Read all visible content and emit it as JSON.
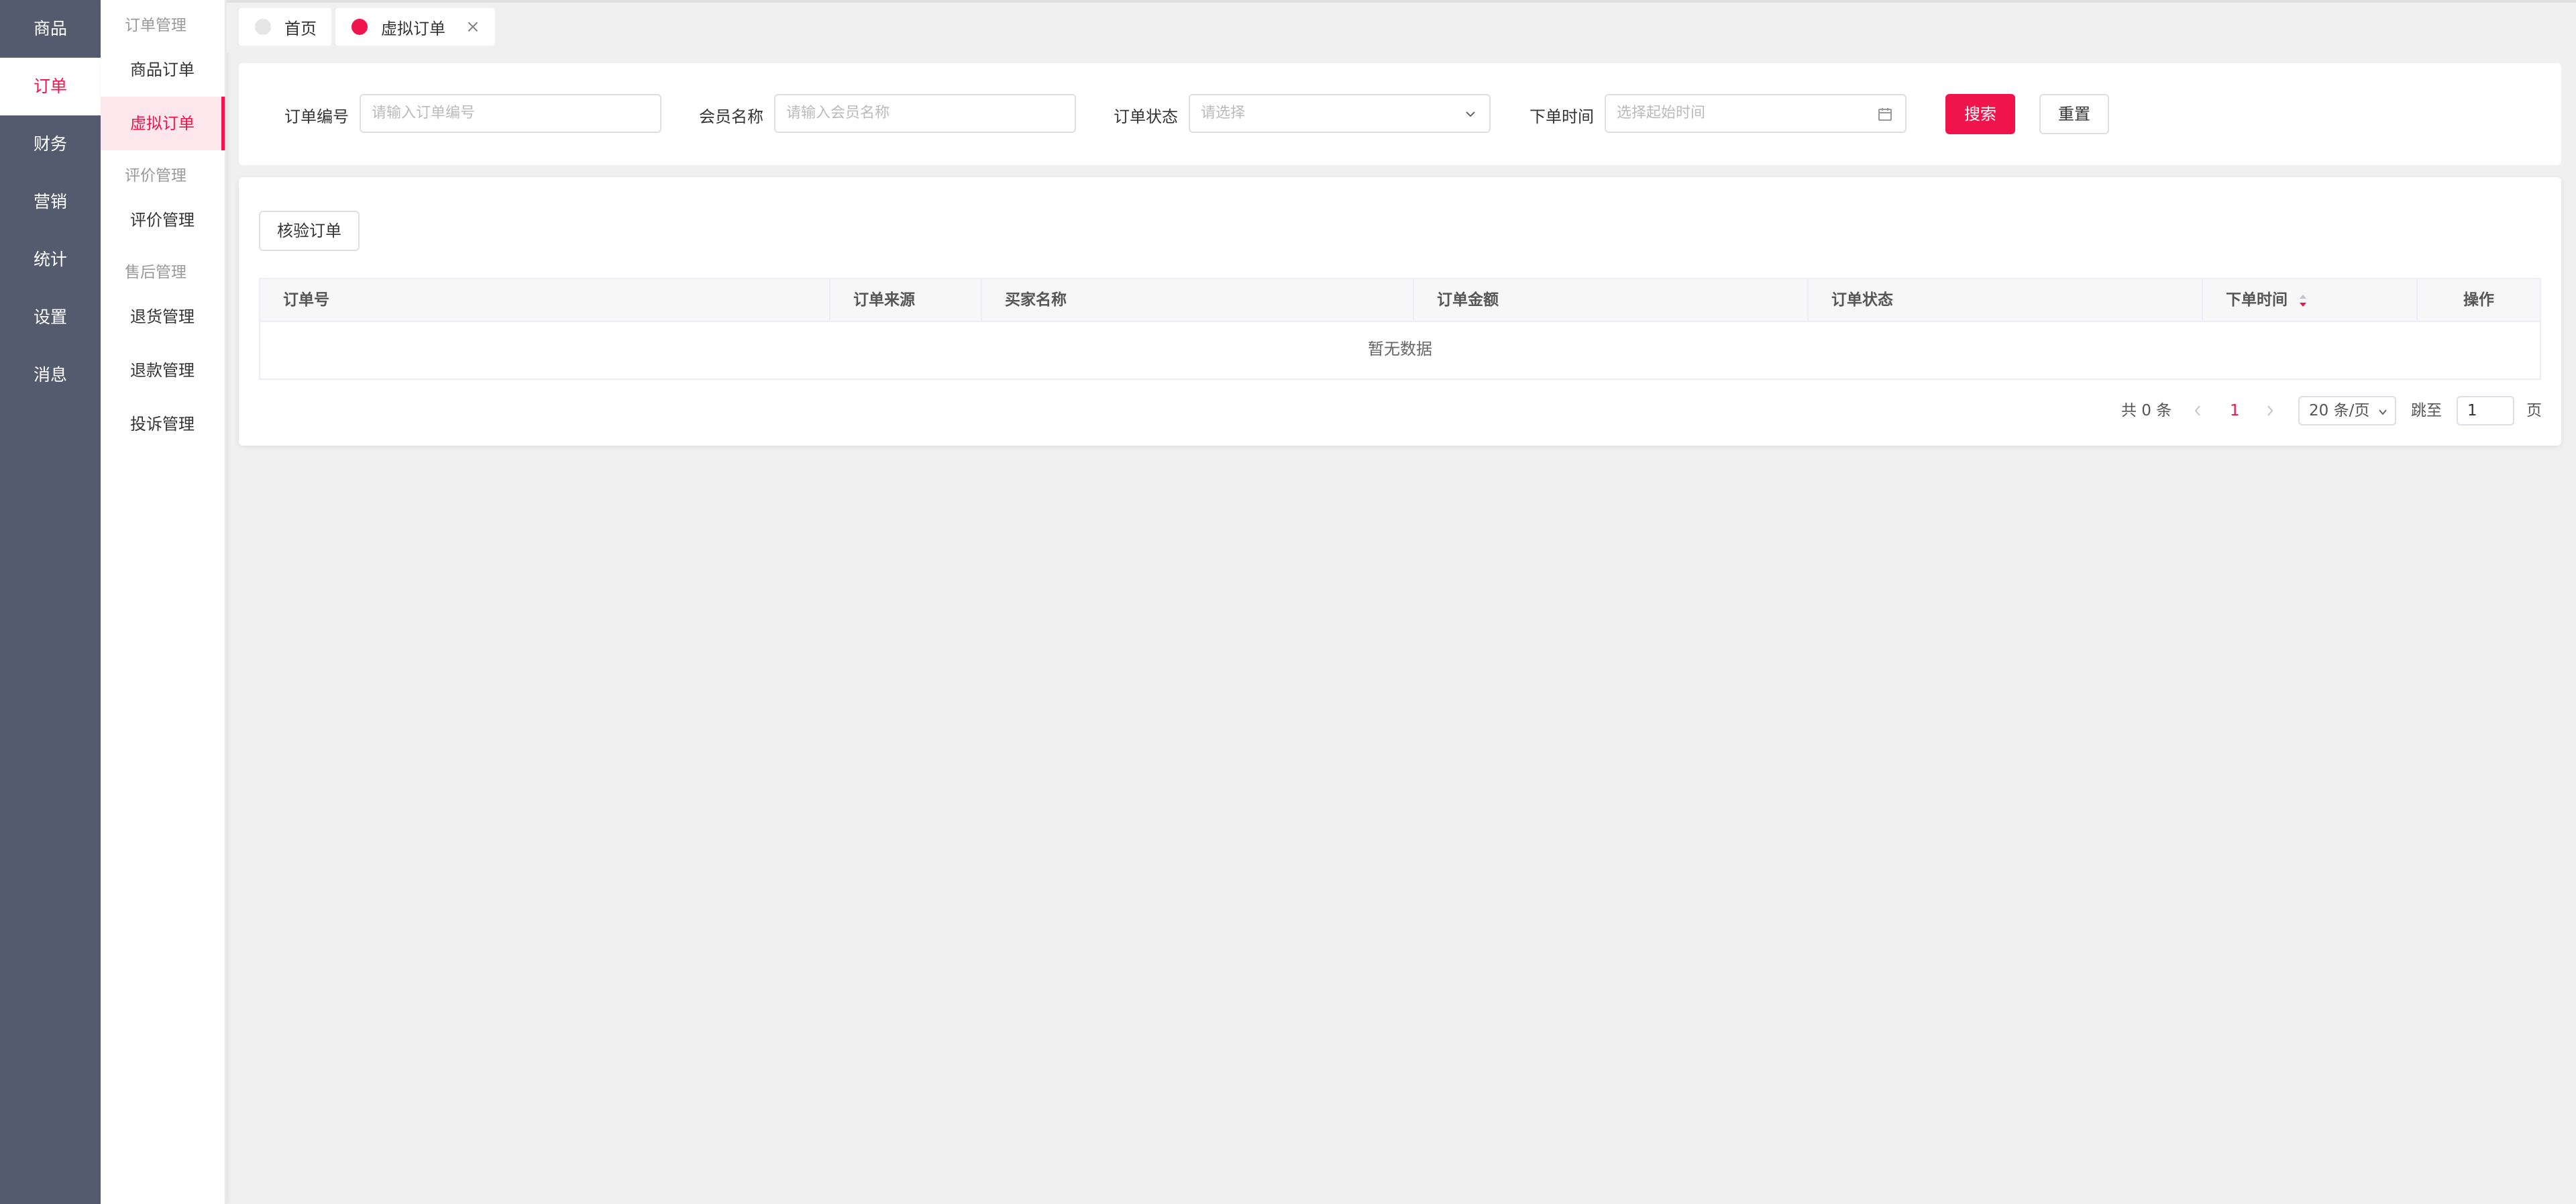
{
  "nav_main": [
    "商品",
    "订单",
    "财务",
    "营销",
    "统计",
    "设置",
    "消息"
  ],
  "nav_sub": {
    "group_order": "订单管理",
    "item_goods_order": "商品订单",
    "item_virtual_order": "虚拟订单",
    "group_review": "评价管理",
    "item_review": "评价管理",
    "group_aftersale": "售后管理",
    "item_return": "退货管理",
    "item_refund": "退款管理",
    "item_complaint": "投诉管理"
  },
  "tabs": {
    "home": "首页",
    "virtual": "虚拟订单",
    "close": "×",
    "home_dot_color": "#e6e6e6",
    "active_dot_color": "#f0144d"
  },
  "search": {
    "order_no_label": "订单编号",
    "order_no_placeholder": "请输入订单编号",
    "member_label": "会员名称",
    "member_placeholder": "请输入会员名称",
    "status_label": "订单状态",
    "status_placeholder": "请选择",
    "time_label": "下单时间",
    "time_placeholder": "选择起始时间",
    "search_btn": "搜索",
    "reset_btn": "重置"
  },
  "toolbar": {
    "verify_btn": "核验订单"
  },
  "table": {
    "columns": [
      "订单号",
      "订单来源",
      "买家名称",
      "订单金额",
      "订单状态",
      "下单时间",
      "操作"
    ],
    "empty_text": "暂无数据"
  },
  "pagination": {
    "total": "共 0 条",
    "current_page": "1",
    "page_size": "20 条/页",
    "goto_label": "跳至",
    "goto_value": "1",
    "page_unit": "页"
  },
  "colors": {
    "accent": "#f0144d",
    "nav_bg": "#545b6e"
  }
}
